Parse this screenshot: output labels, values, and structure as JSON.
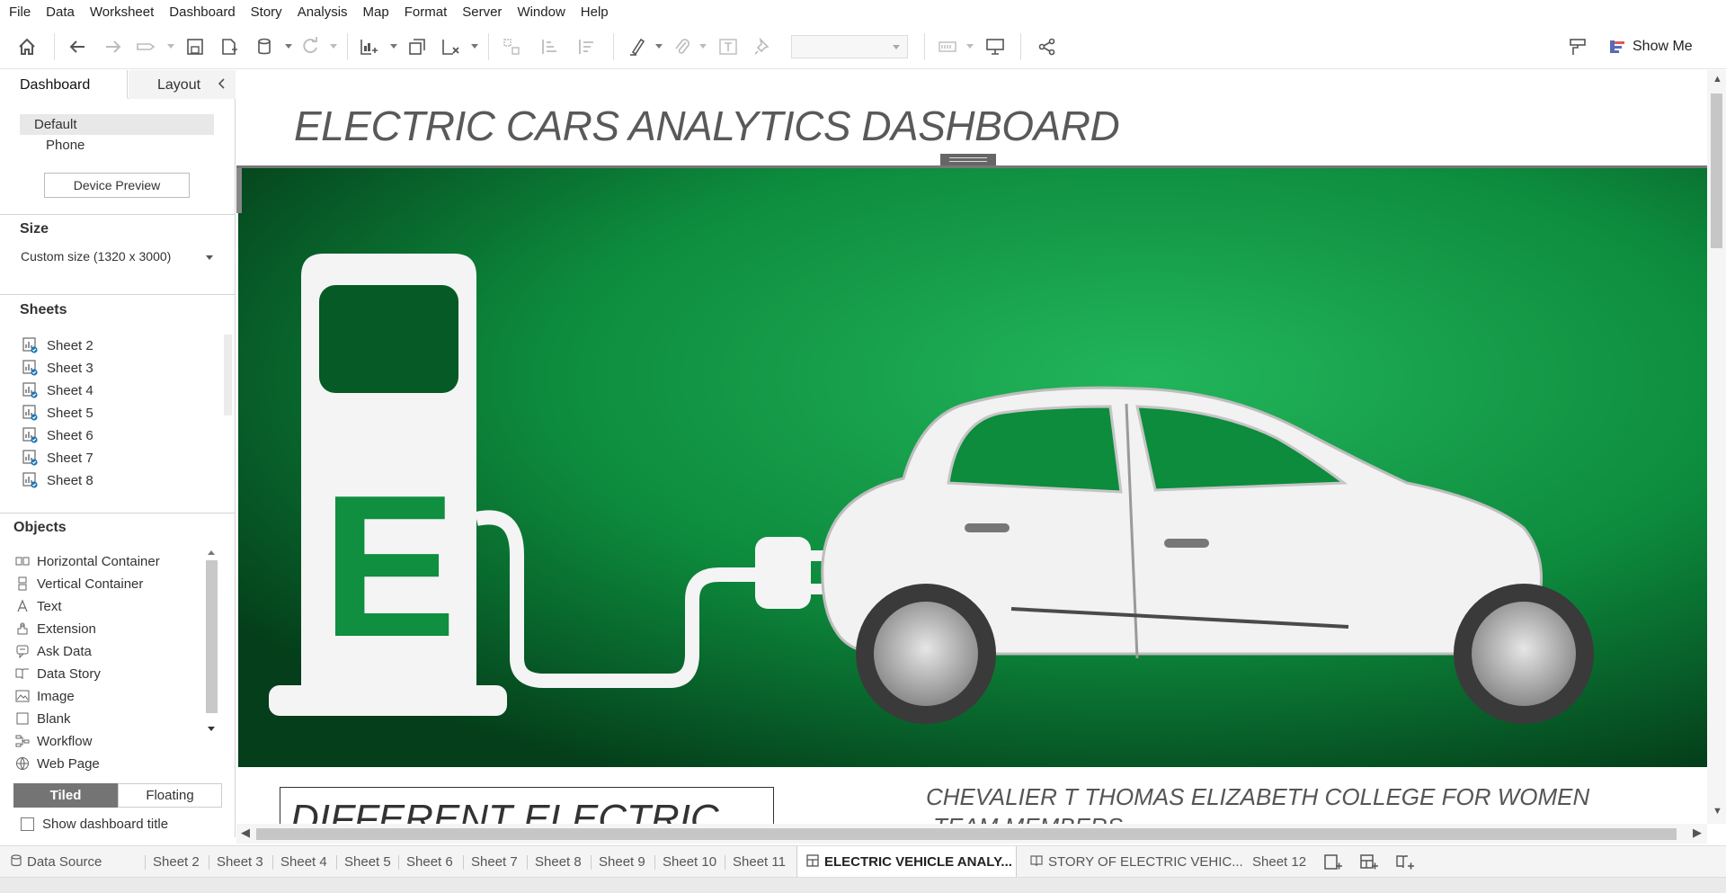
{
  "menu": [
    "File",
    "Data",
    "Worksheet",
    "Dashboard",
    "Story",
    "Analysis",
    "Map",
    "Format",
    "Server",
    "Window",
    "Help"
  ],
  "toolbar": {
    "show_me_label": "Show Me"
  },
  "left_pane": {
    "tab_dashboard": "Dashboard",
    "tab_layout": "Layout",
    "device_default": "Default",
    "device_phone": "Phone",
    "device_preview": "Device Preview",
    "size_title": "Size",
    "size_value": "Custom size (1320 x 3000)",
    "sheets_title": "Sheets",
    "sheets": [
      "Sheet 2",
      "Sheet 3",
      "Sheet 4",
      "Sheet 5",
      "Sheet 6",
      "Sheet 7",
      "Sheet 8"
    ],
    "objects_title": "Objects",
    "objects": [
      {
        "label": "Horizontal Container",
        "icon": "horizontal-container-icon"
      },
      {
        "label": "Vertical Container",
        "icon": "vertical-container-icon"
      },
      {
        "label": "Text",
        "icon": "text-icon"
      },
      {
        "label": "Extension",
        "icon": "extension-icon"
      },
      {
        "label": "Ask Data",
        "icon": "ask-data-icon"
      },
      {
        "label": "Data Story",
        "icon": "data-story-icon"
      },
      {
        "label": "Image",
        "icon": "image-icon"
      },
      {
        "label": "Blank",
        "icon": "blank-icon"
      },
      {
        "label": "Workflow",
        "icon": "workflow-icon"
      },
      {
        "label": "Web Page",
        "icon": "web-page-icon"
      }
    ],
    "tiled": "Tiled",
    "floating": "Floating",
    "show_title": "Show dashboard title"
  },
  "canvas": {
    "title": "ELECTRIC CARS ANALYTICS DASHBOARD",
    "hero_letter": "E",
    "categories_heading": "DIFFERENT ELECTRIC",
    "college": "CHEVALIER T THOMAS ELIZABETH COLLEGE FOR WOMEN",
    "team": "TEAM MEMBERS"
  },
  "colors": {
    "hero_green": "#0b8a3c",
    "accent_blue": "#1f77b4",
    "tab_active": "#ffffff"
  },
  "tabs": {
    "data_source": "Data Source",
    "sheets": [
      "Sheet 2",
      "Sheet 3",
      "Sheet 4",
      "Sheet 5",
      "Sheet 6",
      "Sheet 7",
      "Sheet 8",
      "Sheet 9",
      "Sheet 10",
      "Sheet 11"
    ],
    "active_dashboard": "ELECTRIC VEHICLE ANALY...",
    "story": "STORY OF ELECTRIC VEHIC...",
    "last_sheet": "Sheet 12"
  }
}
